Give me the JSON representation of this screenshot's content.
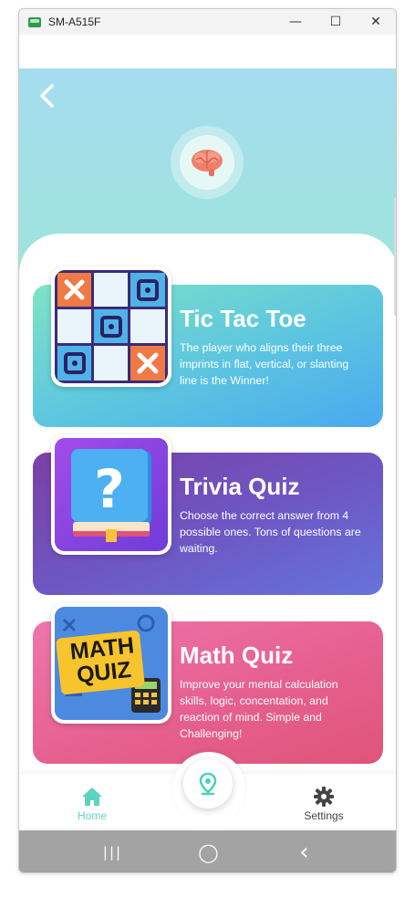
{
  "window": {
    "title": "SM-A515F",
    "minimize_glyph": "—",
    "maximize_glyph": "☐",
    "close_glyph": "✕"
  },
  "header": {
    "back_icon": "chevron-left-icon",
    "badge_icon": "brain-icon"
  },
  "games": [
    {
      "title": "Tic Tac Toe",
      "description": "The player who aligns their three imprints in flat, vertical, or slanting line is the Winner!",
      "gradient": [
        "#7be3c8",
        "#4fb2ee"
      ],
      "icon": "tic-tac-toe-icon"
    },
    {
      "title": "Trivia Quiz",
      "description": "Choose the correct answer from 4 possible ones. Tons of questions are waiting.",
      "gradient": [
        "#7a43a8",
        "#6b6ad6"
      ],
      "icon": "question-book-icon"
    },
    {
      "title": "Math Quiz",
      "description": "Improve your mental calculation skills, logic, concentation, and reaction of mind. Simple and Challenging!",
      "gradient": [
        "#ee72a8",
        "#e0587f"
      ],
      "icon": "math-quiz-icon",
      "thumb_text_line1": "MATH",
      "thumb_text_line2": "QUIZ"
    }
  ],
  "nav": {
    "home_label": "Home",
    "settings_label": "Settings",
    "active_color": "#5fd3c1",
    "inactive_color": "#444444",
    "center_icon": "location-pin-icon"
  },
  "softkeys": {
    "recents": "|||",
    "home": "◯",
    "back": "‹"
  }
}
